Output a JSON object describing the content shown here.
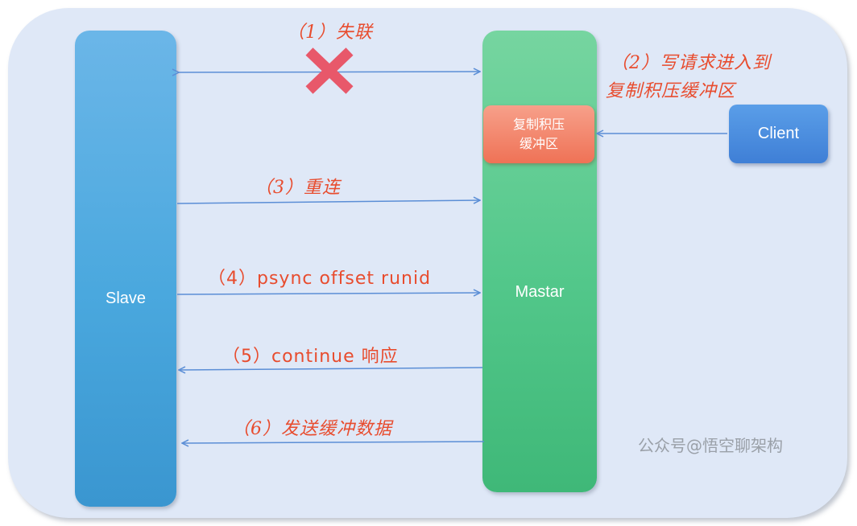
{
  "nodes": {
    "slave": "Slave",
    "master": "Mastar",
    "client": "Client",
    "buffer_line1": "复制积压",
    "buffer_line2": "缓冲区"
  },
  "steps": {
    "s1": "（1）失联",
    "s2_line1": "（2）写请求进入到",
    "s2_line2": "复制积压缓冲区",
    "s3": "（3）重连",
    "s4": "（4）psync offset runid",
    "s5": "（5）continue 响应",
    "s6": "（6）发送缓冲数据"
  },
  "watermark": "公众号@悟空聊架构",
  "colors": {
    "panel": "#dfe8f7",
    "slave": "#4aa8de",
    "master": "#52c78a",
    "buffer": "#ef7256",
    "client": "#3f7fd6",
    "arrow": "#5b8ed6",
    "step_text": "#e84c2e",
    "cross": "#e8586a"
  },
  "icons": {
    "disconnect": "cross-icon"
  }
}
